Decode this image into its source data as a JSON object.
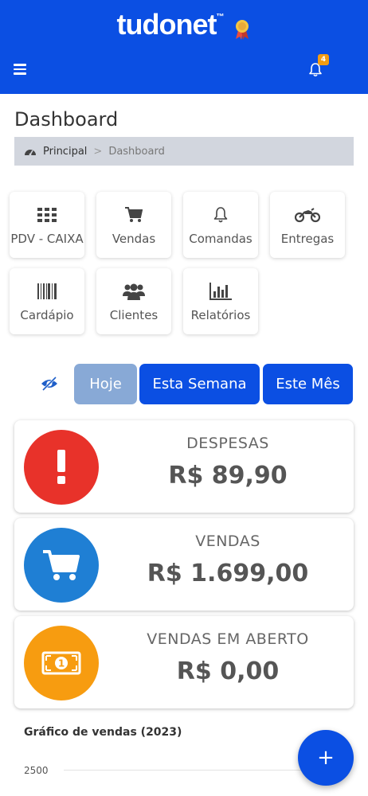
{
  "header": {
    "logo_text": "tudonet",
    "logo_tm": "™",
    "notification_count": "4",
    "color": "#0b4fe3"
  },
  "page": {
    "title": "Dashboard"
  },
  "breadcrumb": {
    "home": "Principal",
    "separator": ">",
    "current": "Dashboard"
  },
  "shortcuts": [
    {
      "label": "PDV - CAIXA",
      "icon": "grid-icon"
    },
    {
      "label": "Vendas",
      "icon": "cart-icon"
    },
    {
      "label": "Comandas",
      "icon": "bell-icon"
    },
    {
      "label": "Entregas",
      "icon": "motorcycle-icon"
    },
    {
      "label": "Cardápio",
      "icon": "barcode-icon"
    },
    {
      "label": "Clientes",
      "icon": "users-icon"
    },
    {
      "label": "Relatórios",
      "icon": "bar-chart-icon"
    }
  ],
  "filters": {
    "today": "Hoje",
    "week": "Esta Semana",
    "month": "Este Mês",
    "selected": "Hoje"
  },
  "stats": [
    {
      "label": "DESPESAS",
      "value": "R$ 89,90",
      "color": "#e8322a",
      "icon": "exclamation-icon"
    },
    {
      "label": "VENDAS",
      "value": "R$ 1.699,00",
      "color": "#1f7fd4",
      "icon": "cart-icon"
    },
    {
      "label": "VENDAS EM ABERTO",
      "value": "R$ 0,00",
      "color": "#f79c10",
      "icon": "money-icon"
    }
  ],
  "chart": {
    "title": "Gráfico de vendas (2023)",
    "first_tick": "2500"
  },
  "fab": {
    "label": "+"
  }
}
